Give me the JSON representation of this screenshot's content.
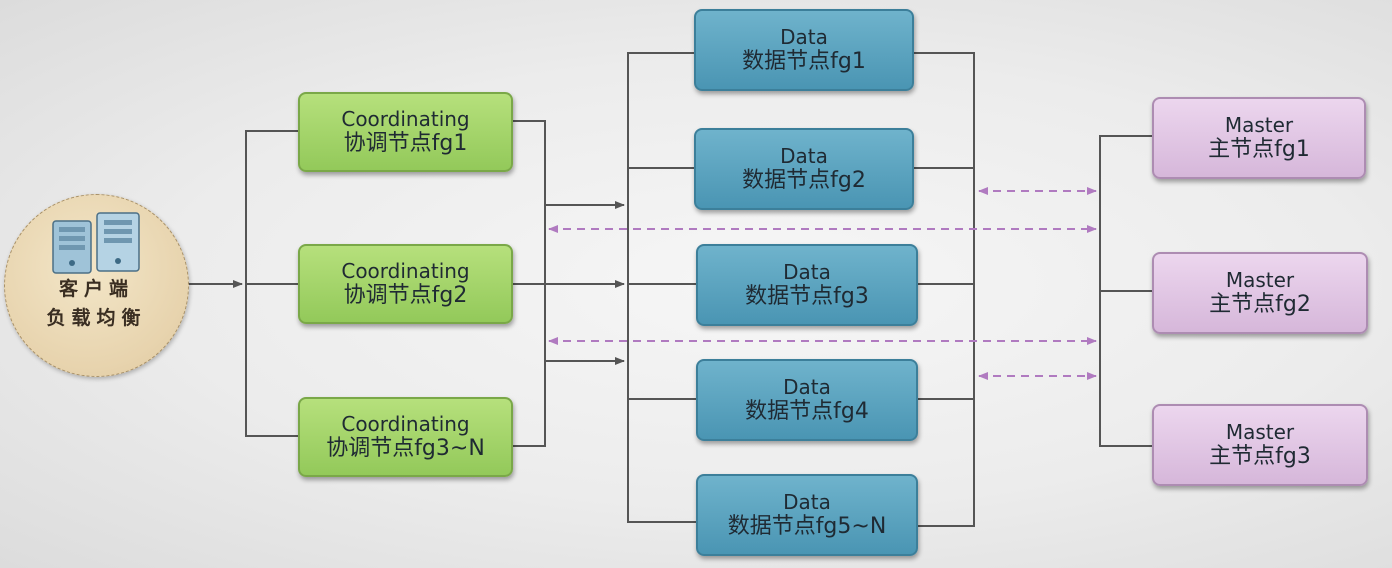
{
  "client": {
    "line1": "客户端",
    "line2": "负载均衡",
    "icon": "server-icon"
  },
  "coordinating": [
    {
      "title": "Coordinating",
      "label": "协调节点fg1"
    },
    {
      "title": "Coordinating",
      "label": "协调节点fg2"
    },
    {
      "title": "Coordinating",
      "label": "协调节点fg3~N"
    }
  ],
  "data_nodes": [
    {
      "title": "Data",
      "label": "数据节点fg1"
    },
    {
      "title": "Data",
      "label": "数据节点fg2"
    },
    {
      "title": "Data",
      "label": "数据节点fg3"
    },
    {
      "title": "Data",
      "label": "数据节点fg4"
    },
    {
      "title": "Data",
      "label": "数据节点fg5~N"
    }
  ],
  "master_nodes": [
    {
      "title": "Master",
      "label": "主节点fg1"
    },
    {
      "title": "Master",
      "label": "主节点fg2"
    },
    {
      "title": "Master",
      "label": "主节点fg3"
    }
  ],
  "colors": {
    "coordinating": "#9fd266",
    "data": "#5aa3c0",
    "master": "#e0c6e3",
    "client": "#e8d5b0",
    "connector": "#555555",
    "dashed_link": "#b07ac0"
  }
}
